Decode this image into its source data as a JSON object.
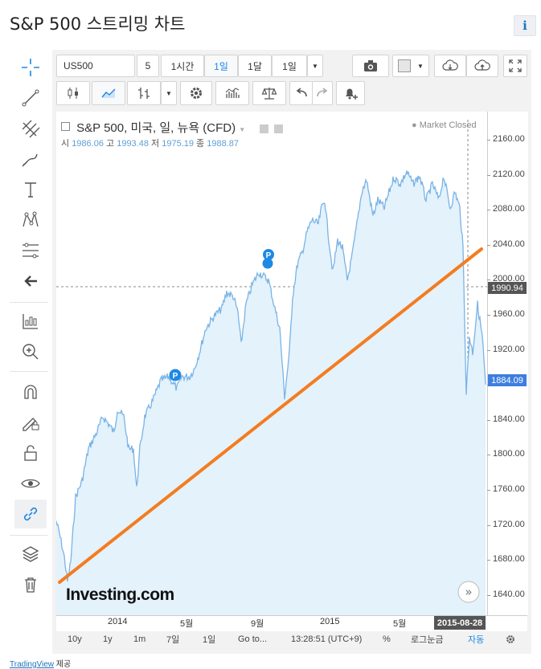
{
  "page_title": "S&P 500 스트리밍 차트",
  "info_label": "i",
  "toolbar": {
    "symbol": "US500",
    "interval_number": "5",
    "intervals": [
      "1시간",
      "1일",
      "1달",
      "1일"
    ],
    "active_interval": "1일"
  },
  "chart": {
    "title": "S&P 500, 미국, 일, 뉴욕 (CFD)",
    "status": "Market Closed",
    "ohlc": [
      {
        "label": "시",
        "value": "1986.06"
      },
      {
        "label": "고",
        "value": "1993.48"
      },
      {
        "label": "저",
        "value": "1975.19"
      },
      {
        "label": "종",
        "value": "1988.87"
      }
    ],
    "price_axis_ticks": [
      "2160.00",
      "2120.00",
      "2080.00",
      "2040.00",
      "2000.00",
      "1960.00",
      "1920.00",
      "1880.00",
      "1840.00",
      "1800.00",
      "1760.00",
      "1720.00",
      "1680.00",
      "1640.00"
    ],
    "crosshair_price": "1990.94",
    "last_price": "1884.09",
    "time_axis_labels": [
      "2014",
      "5월",
      "9월",
      "2015",
      "5월"
    ],
    "crosshair_date": "2015-08-28",
    "watermark": "Investing.com",
    "marker_label": "P",
    "scroll_label": "»"
  },
  "bottom_bar": {
    "ranges": [
      "10y",
      "1y",
      "1m",
      "7일",
      "1일"
    ],
    "goto": "Go to...",
    "clock": "13:28:51 (UTC+9)",
    "percent": "%",
    "log": "로그눈금",
    "auto": "자동"
  },
  "footer": {
    "brand": "TradingView",
    "suffix": " 제공"
  },
  "colors": {
    "series_line": "#7ab3e6",
    "series_fill": "#e3f2fb",
    "trend_line": "#f47c20",
    "accent": "#1e88e5",
    "last_price_bg": "#3d7ee0",
    "crosshair_bg": "#555555"
  }
}
